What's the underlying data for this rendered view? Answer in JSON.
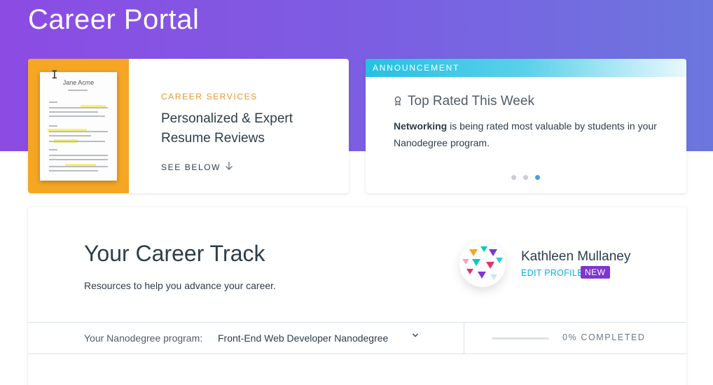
{
  "header": {
    "title": "Career Portal"
  },
  "career_services": {
    "eyebrow": "CAREER SERVICES",
    "title": "Personalized & Expert Resume Reviews",
    "link_label": "SEE BELOW",
    "resume_name": "Jane Acme",
    "accent_color": "#f5a623"
  },
  "announcement": {
    "label": "ANNOUNCEMENT",
    "title": "Top Rated This Week",
    "body_bold": "Networking",
    "body_rest": " is being rated most valuable by students in your Nanodegree program.",
    "carousel_active_index": 2,
    "carousel_count": 3
  },
  "career_track": {
    "title": "Your Career Track",
    "subtitle": "Resources to help you advance your career."
  },
  "profile": {
    "name": "Kathleen Mullaney",
    "edit_label": "EDIT PROFILE",
    "badge": "NEW"
  },
  "program": {
    "label": "Your Nanodegree program:",
    "selected": "Front-End Web Developer Nanodegree",
    "progress_percent": 0,
    "progress_text": "0% COMPLETED"
  },
  "icons": {
    "cursor": "text-cursor-icon",
    "arrow": "arrow-down-icon",
    "ribbon": "award-ribbon-icon",
    "chevron": "chevron-down-icon"
  }
}
